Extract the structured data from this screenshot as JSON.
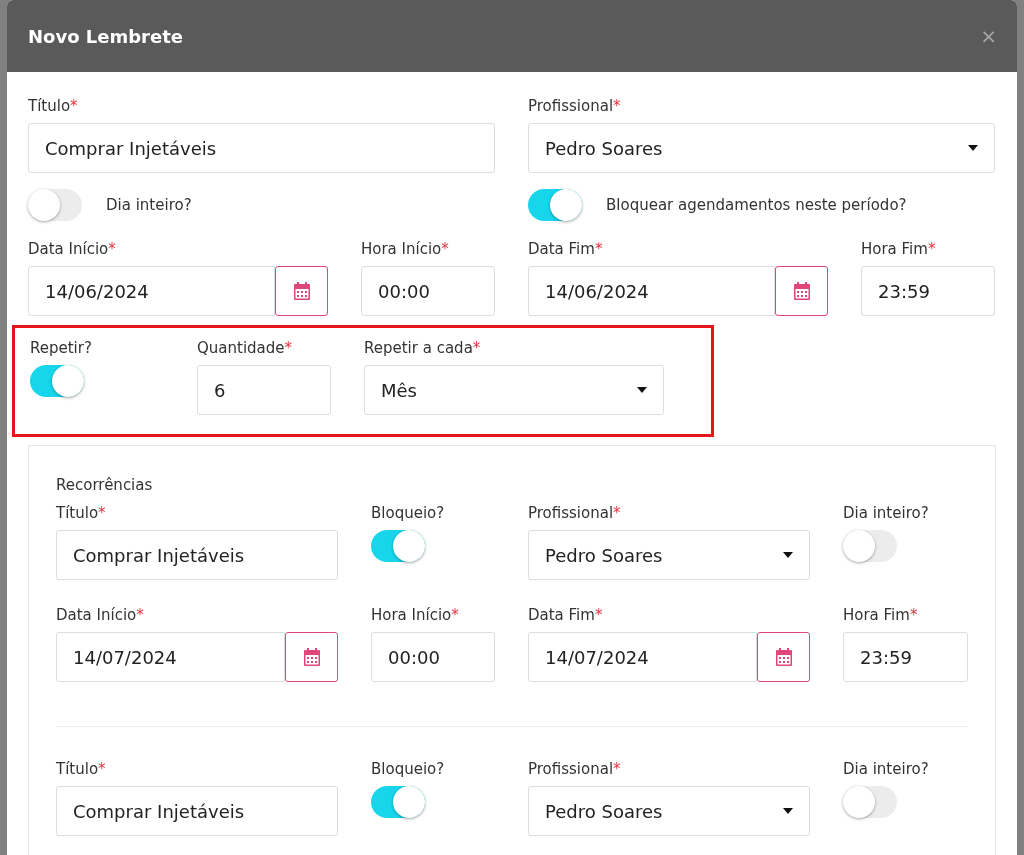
{
  "dialog": {
    "title": "Novo Lembrete",
    "close": "×"
  },
  "form": {
    "rows": [
      [
        {
          "kind": "text",
          "label": "Título",
          "required_mark": "*",
          "value": "Comprar Injetáveis"
        },
        {
          "kind": "select",
          "label": "Profissional",
          "required_mark": "*",
          "value": "Pedro Soares"
        }
      ],
      [
        {
          "kind": "switch",
          "label": "Dia inteiro?",
          "on": false
        },
        {
          "kind": "switch",
          "label": "Bloquear agendamentos neste período?",
          "on": true
        }
      ],
      [
        {
          "kind": "date",
          "label": "Data Início",
          "required_mark": "*",
          "value": "14/06/2024"
        },
        {
          "kind": "text",
          "label": "Hora Início",
          "required_mark": "*",
          "value": "00:00"
        },
        {
          "kind": "date",
          "label": "Data Fim",
          "required_mark": "*",
          "value": "14/06/2024"
        },
        {
          "kind": "text",
          "label": "Hora Fim",
          "required_mark": "*",
          "value": "23:59"
        }
      ]
    ]
  },
  "repeat": {
    "highlighted": true,
    "fields": [
      {
        "kind": "toggle",
        "label": "Repetir?",
        "on": true
      },
      {
        "kind": "text",
        "label": "Quantidade",
        "required_mark": "*",
        "value": "6"
      },
      {
        "kind": "select",
        "label": "Repetir a cada",
        "required_mark": "*",
        "value": "Mês"
      }
    ]
  },
  "recurrences": {
    "title": "Recorrências",
    "items": [
      {
        "rows": [
          [
            {
              "kind": "text",
              "label": "Título",
              "required_mark": "*",
              "value": "Comprar Injetáveis"
            },
            {
              "kind": "toggle",
              "label": "Bloqueio?",
              "on": true
            },
            {
              "kind": "select",
              "label": "Profissional",
              "required_mark": "*",
              "value": "Pedro Soares"
            },
            {
              "kind": "toggle",
              "label": "Dia inteiro?",
              "on": false
            }
          ],
          [
            {
              "kind": "date",
              "label": "Data Início",
              "required_mark": "*",
              "value": "14/07/2024"
            },
            {
              "kind": "text",
              "label": "Hora Início",
              "required_mark": "*",
              "value": "00:00"
            },
            {
              "kind": "date",
              "label": "Data Fim",
              "required_mark": "*",
              "value": "14/07/2024"
            },
            {
              "kind": "text",
              "label": "Hora Fim",
              "required_mark": "*",
              "value": "23:59"
            }
          ]
        ]
      },
      {
        "rows": [
          [
            {
              "kind": "text",
              "label": "Título",
              "required_mark": "*",
              "value": "Comprar Injetáveis"
            },
            {
              "kind": "toggle",
              "label": "Bloqueio?",
              "on": true
            },
            {
              "kind": "select",
              "label": "Profissional",
              "required_mark": "*",
              "value": "Pedro Soares"
            },
            {
              "kind": "toggle",
              "label": "Dia inteiro?",
              "on": false
            }
          ]
        ]
      }
    ]
  }
}
